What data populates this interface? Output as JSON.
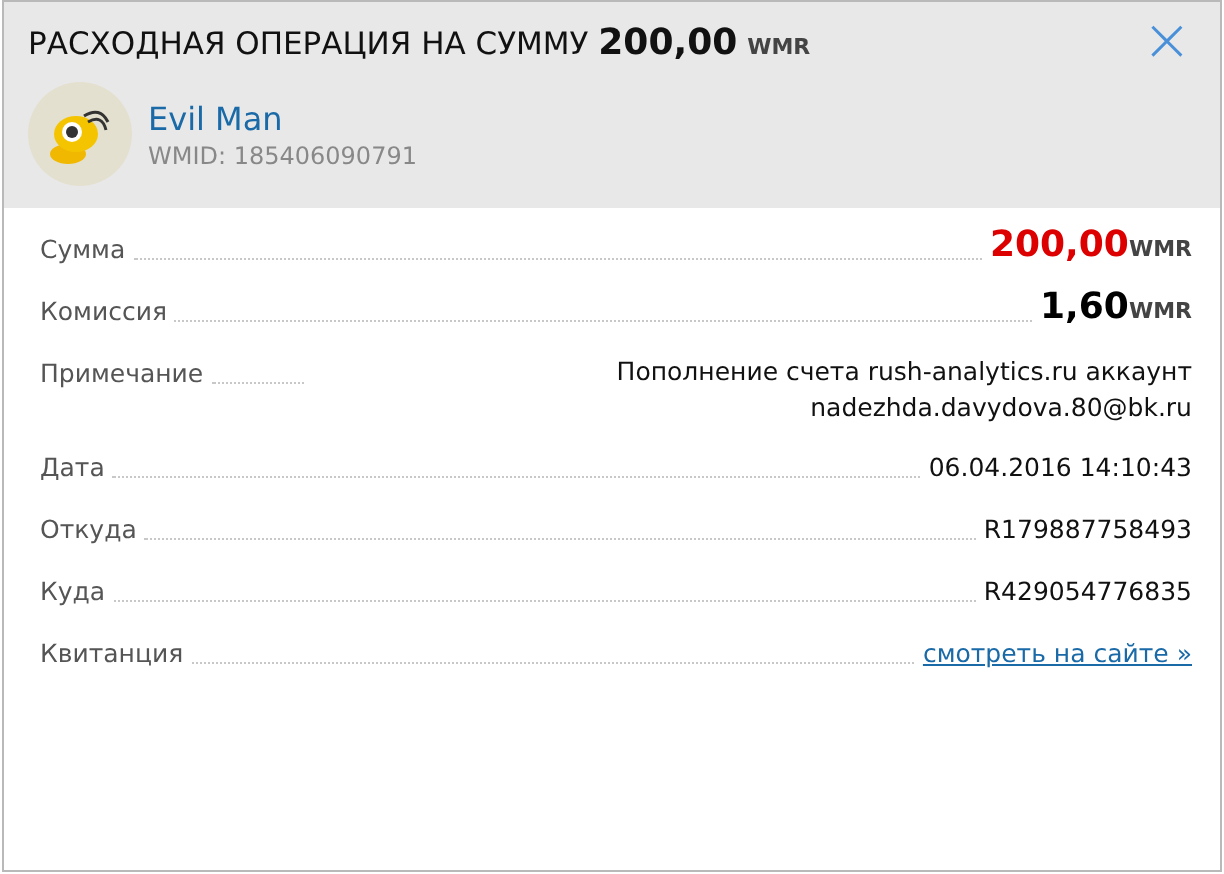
{
  "header": {
    "title": "РАСХОДНАЯ ОПЕРАЦИЯ НА СУММУ",
    "amount": "200,00",
    "currency": "WMR",
    "close": "×"
  },
  "user": {
    "name": "Evil Man",
    "wmid": "WMID: 185406090791"
  },
  "rows": [
    {
      "kind": "amount",
      "label": "Сумма",
      "value": "200,00",
      "currency": "WMR",
      "color": "#dd0000"
    },
    {
      "kind": "amount",
      "label": "Комиссия",
      "value": "1,60",
      "currency": "WMR",
      "color": "#000000"
    },
    {
      "kind": "note",
      "label": "Примечание",
      "value": "Пополнение счета rush-analytics.ru аккаунт nadezhda.davydova.80@bk.ru"
    },
    {
      "kind": "text",
      "label": "Дата",
      "value": "06.04.2016 14:10:43"
    },
    {
      "kind": "text",
      "label": "Откуда",
      "value": "R179887758493"
    },
    {
      "kind": "text",
      "label": "Куда",
      "value": "R429054776835"
    },
    {
      "kind": "link",
      "label": "Квитанция",
      "value": "смотреть на сайте »"
    }
  ]
}
